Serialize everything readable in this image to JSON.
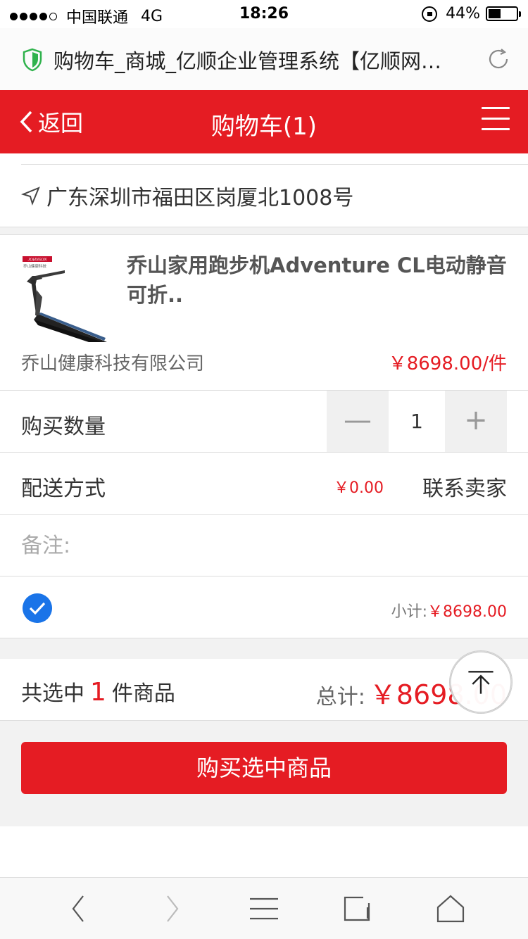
{
  "status_bar": {
    "carrier": "中国联通",
    "network": "4G",
    "time": "18:26",
    "battery": "44%"
  },
  "browser": {
    "url_title": "购物车_商城_亿顺企业管理系统【亿顺网…"
  },
  "header": {
    "back_label": "返回",
    "title": "购物车(1)"
  },
  "address": {
    "text": "广东深圳市福田区岗厦北1008号"
  },
  "product": {
    "name": "乔山家用跑步机Adventure CL电动静音可折..",
    "company": "乔山健康科技有限公司",
    "unit_price": "￥8698.00/件",
    "image_brand": "JOHNSON",
    "image_brand_sub": "乔山健康科技"
  },
  "quantity": {
    "label": "购买数量",
    "minus": "—",
    "value": "1",
    "plus": "+"
  },
  "shipping": {
    "label": "配送方式",
    "price": "￥0.00",
    "contact_label": "联系卖家"
  },
  "remark": {
    "placeholder": "备注:"
  },
  "subtotal": {
    "label": "小计:",
    "amount": "￥8698.00"
  },
  "summary": {
    "prefix": "共选中",
    "count": "1",
    "suffix": "件商品",
    "total_label": "总计:",
    "total": "￥8698.00"
  },
  "buy_button": {
    "label": "购买选中商品"
  },
  "colors": {
    "brand_red": "#e51c23",
    "check_blue": "#1a74e8"
  }
}
